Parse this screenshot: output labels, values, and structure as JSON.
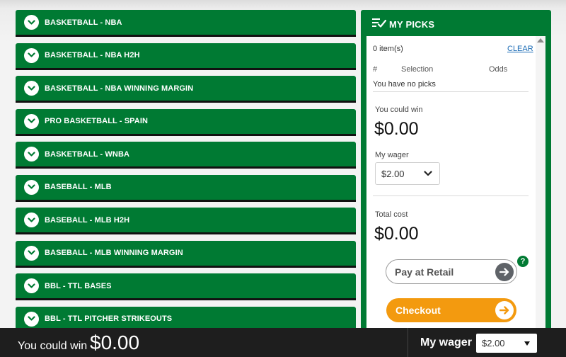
{
  "sports": [
    {
      "label": "BASKETBALL - NBA"
    },
    {
      "label": "BASKETBALL - NBA H2H"
    },
    {
      "label": "BASKETBALL - NBA WINNING MARGIN"
    },
    {
      "label": "PRO BASKETBALL - SPAIN"
    },
    {
      "label": "BASKETBALL - WNBA"
    },
    {
      "label": "BASEBALL - MLB"
    },
    {
      "label": "BASEBALL - MLB H2H"
    },
    {
      "label": "BASEBALL - MLB WINNING MARGIN"
    },
    {
      "label": "BBL - TTL BASES"
    },
    {
      "label": "BBL - TTL PITCHER STRIKEOUTS"
    }
  ],
  "picks": {
    "title": "MY PICKS",
    "items_count": "0 item(s)",
    "clear_label": "CLEAR",
    "columns": {
      "hash": "#",
      "selection": "Selection",
      "odds": "Odds"
    },
    "empty_message": "You have no picks",
    "could_win_label": "You could win",
    "could_win_value": "$0.00",
    "wager_label": "My wager",
    "wager_value": "$2.00",
    "total_cost_label": "Total cost",
    "total_cost_value": "$0.00",
    "pay_retail_label": "Pay at Retail",
    "help_label": "?",
    "checkout_label": "Checkout"
  },
  "bottom_bar": {
    "could_win_label": "You could win",
    "could_win_value": "$0.00",
    "wager_label": "My wager",
    "wager_value": "$2.00"
  },
  "colors": {
    "brand_green": "#007a33",
    "checkout_orange": "#f39a0f",
    "bar_background": "#1e1e1e"
  },
  "icons": [
    "chevron-down-icon",
    "picks-list-icon",
    "arrow-right-icon",
    "help-icon",
    "scroll-up-icon",
    "caret-down-icon"
  ]
}
